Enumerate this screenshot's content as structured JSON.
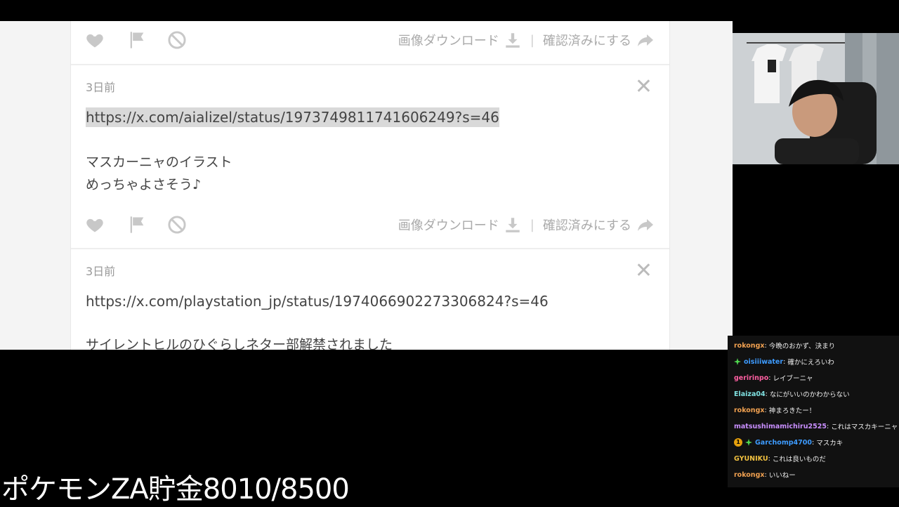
{
  "cards": [
    {
      "actions": {
        "download_label": "画像ダウンロード",
        "confirm_label": "確認済みにする"
      }
    },
    {
      "timestamp": "3日前",
      "url": "https://x.com/aializel/status/1973749811741606249?s=46",
      "lines": [
        "マスカーニャのイラスト",
        "めっちゃよさそう♪"
      ],
      "actions": {
        "download_label": "画像ダウンロード",
        "confirm_label": "確認済みにする"
      }
    },
    {
      "timestamp": "3日前",
      "url": "https://x.com/playstation_jp/status/1974066902273306824?s=46",
      "lines": [
        "サイレントヒルのひぐらしネター部解禁されました"
      ]
    }
  ],
  "chat": [
    {
      "user": "rokongx",
      "color": "#f0a050",
      "message": "今晩のおかず、決まり",
      "badges": []
    },
    {
      "user": "oisiiiwater",
      "color": "#3d9bff",
      "message": "確かにえろいわ",
      "badges": [
        "green-sparkle-badge"
      ]
    },
    {
      "user": "geririnpo",
      "color": "#ff5fa2",
      "message": "レイブーニャ",
      "badges": []
    },
    {
      "user": "Elaiza04",
      "color": "#7fe0e0",
      "message": "なにがいいのかわからない",
      "badges": []
    },
    {
      "user": "rokongx",
      "color": "#f0a050",
      "message": "神まろきたー！",
      "badges": []
    },
    {
      "user": "matsushimamichiru2525",
      "color": "#c98fff",
      "message": "これはマスカキーニャ",
      "badges": []
    },
    {
      "user": "Garchomp4700",
      "color": "#3d9bff",
      "message": "マスカキ",
      "badges": [
        "one-badge",
        "green-sparkle-badge"
      ]
    },
    {
      "user": "GYUNIKU",
      "color": "#f0c040",
      "message": "これは良いものだ",
      "badges": []
    },
    {
      "user": "rokongx",
      "color": "#f0a050",
      "message": "いいねー",
      "badges": []
    }
  ],
  "chat_badge_one": "1",
  "savings_text": "ポケモンZA貯金8010/8500",
  "colors": {
    "icon_gray": "#c8c8c8",
    "text_gray": "#aaaaaa"
  }
}
